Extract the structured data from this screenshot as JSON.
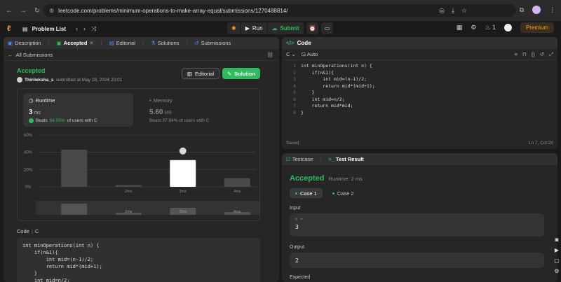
{
  "browser": {
    "url": "leetcode.com/problems/minimum-operations-to-make-array-equal/submissions/1270488814/",
    "site_icon": "site-info-icon"
  },
  "topbar": {
    "problem_list": "Problem List",
    "run": "Run",
    "submit": "Submit",
    "streak": "1",
    "premium": "Premium"
  },
  "left": {
    "tabs": [
      "Description",
      "Accepted",
      "Editorial",
      "Solutions",
      "Submissions"
    ],
    "all_submissions": "All Submissions",
    "status": "Accepted",
    "submitter_name": "Thirileksha_s",
    "submitted_text": "submitted at May 28, 2024 20:01",
    "editorial_btn": "Editorial",
    "solution_btn": "Solution",
    "runtime_label": "Runtime",
    "runtime_value": "3",
    "runtime_unit": "ms",
    "runtime_beats_prefix": "Beats",
    "runtime_beats_pct": "54.05%",
    "runtime_beats_suffix": "of users with C",
    "memory_label": "Memory",
    "memory_value": "5.60",
    "memory_unit": "MB",
    "memory_beats": "Beats 37.84% of users with C",
    "code_label": "Code",
    "code_lang": "C",
    "code_lines": [
      "int minOperations(int n) {",
      "    if(n&1){",
      "        int mid=(n-1)/2;",
      "        return mid*(mid+1);",
      "    }",
      "    int mid=n/2;"
    ]
  },
  "chart_data": {
    "type": "bar",
    "categories": [
      "",
      "2ms",
      "3ms",
      "4ms"
    ],
    "values": [
      43,
      2,
      31,
      10
    ],
    "highlight_index": 2,
    "y_ticks": [
      "60%",
      "40%",
      "20%",
      "0%"
    ],
    "ylim": [
      0,
      60
    ],
    "mini_labels": [
      "2ms",
      "3ms",
      "4ms"
    ]
  },
  "right": {
    "code_header": "Code",
    "lang": "C",
    "auto": "Auto",
    "line_numbers": [
      "1",
      "2",
      "3",
      "4",
      "5",
      "6",
      "7",
      "8"
    ],
    "editor_lines": [
      "int minOperations(int n) {",
      "    if(n&1){",
      "        int mid=(n-1)/2;",
      "        return mid*(mid+1);",
      "    }",
      "    int mid=n/2;",
      "    return mid*mid;",
      "}"
    ],
    "saved": "Saved",
    "cursor_pos": "Ln 7, Col 20"
  },
  "test": {
    "tab_testcase": "Testcase",
    "tab_result": "Test Result",
    "status": "Accepted",
    "runtime": "Runtime: 2 ms",
    "case1": "Case 1",
    "case2": "Case 2",
    "input_label": "Input",
    "input_var": "n =",
    "input_val": "3",
    "output_label": "Output",
    "output_val": "2",
    "expected_label": "Expected"
  },
  "colors": {
    "accent_green": "#2cbb5d",
    "premium_orange": "#ffa116",
    "panel_bg": "#262626"
  }
}
